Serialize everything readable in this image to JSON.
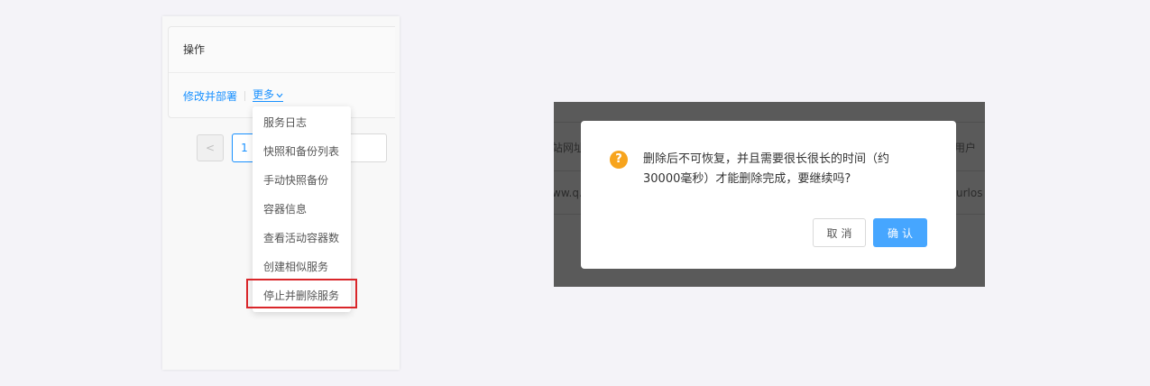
{
  "left": {
    "table_header": "操作",
    "row": {
      "edit_deploy_link": "修改并部署",
      "more_link": "更多"
    },
    "pagination": {
      "prev_symbol": "<",
      "current_page": "1"
    },
    "dropdown": {
      "items": [
        "服务日志",
        "快照和备份列表",
        "手动快照备份",
        "容器信息",
        "查看活动容器数",
        "创建相似服务",
        "停止并删除服务"
      ],
      "highlighted_index": 6
    }
  },
  "right": {
    "background_fragments": {
      "header_left": "站网址",
      "header_right": "用户",
      "row_left": "ww.q.c",
      "row_right": "urlos"
    },
    "dialog": {
      "icon": "question-icon",
      "icon_glyph": "?",
      "icon_color": "#f7a41d",
      "message": "删除后不可恢复，并且需要很长很长的时间（约30000毫秒）才能删除完成，要继续吗?",
      "cancel_label": "取消",
      "confirm_label": "确认",
      "confirm_color": "#46a6ff"
    }
  },
  "colors": {
    "link": "#1890ff",
    "highlight_border": "#d9262a",
    "overlay": "#5a5a5a"
  }
}
